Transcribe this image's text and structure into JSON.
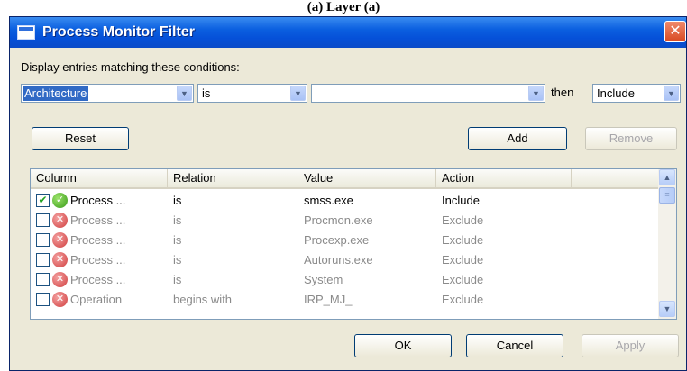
{
  "caption": "(a) Layer (a)",
  "window": {
    "title": "Process Monitor Filter"
  },
  "filter": {
    "instruction": "Display entries matching these conditions:",
    "column_value": "Architecture",
    "relation_value": "is",
    "value_value": "",
    "then_label": "then",
    "action_value": "Include"
  },
  "buttons": {
    "reset": "Reset",
    "add": "Add",
    "remove": "Remove",
    "ok": "OK",
    "cancel": "Cancel",
    "apply": "Apply"
  },
  "table": {
    "headers": [
      "Column",
      "Relation",
      "Value",
      "Action"
    ],
    "rows": [
      {
        "checked": true,
        "column": "Process ...",
        "relation": "is",
        "value": "smss.exe",
        "action": "Include",
        "status_icon": "check-circle-icon"
      },
      {
        "checked": false,
        "column": "Process ...",
        "relation": "is",
        "value": "Procmon.exe",
        "action": "Exclude",
        "status_icon": "x-circle-icon"
      },
      {
        "checked": false,
        "column": "Process ...",
        "relation": "is",
        "value": "Procexp.exe",
        "action": "Exclude",
        "status_icon": "x-circle-icon"
      },
      {
        "checked": false,
        "column": "Process ...",
        "relation": "is",
        "value": "Autoruns.exe",
        "action": "Exclude",
        "status_icon": "x-circle-icon"
      },
      {
        "checked": false,
        "column": "Process ...",
        "relation": "is",
        "value": "System",
        "action": "Exclude",
        "status_icon": "x-circle-icon"
      },
      {
        "checked": false,
        "column": "Operation",
        "relation": "begins with",
        "value": "IRP_MJ_",
        "action": "Exclude",
        "status_icon": "x-circle-icon"
      }
    ]
  },
  "colors": {
    "title_bar": "#0550d8",
    "include_icon": "#3a9a1a",
    "exclude_icon": "#d04040"
  }
}
